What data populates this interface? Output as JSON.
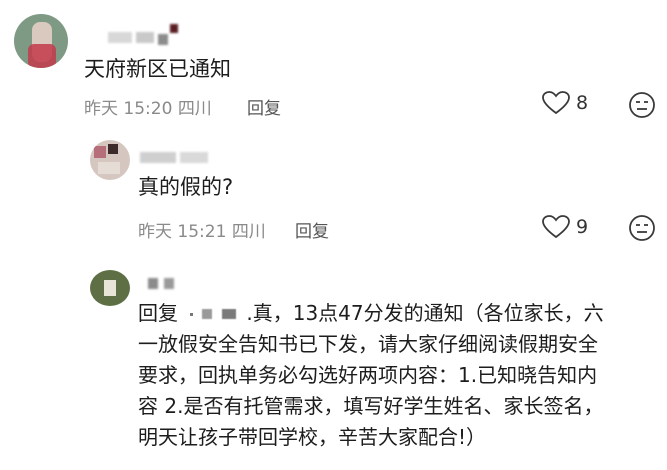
{
  "comments": [
    {
      "text": "天府新区已通知",
      "time": "昨天 15:20",
      "location": "四川",
      "reply_label": "回复",
      "likes": "8"
    },
    {
      "text": "真的假的?",
      "time": "昨天 15:21",
      "location": "四川",
      "reply_label": "回复",
      "likes": "9"
    },
    {
      "reply_prefix": "回复",
      "lines": [
        ".真，13点47分发的通知（各位家长，六",
        "一放假安全告知书已下发，请大家仔细阅读假期安全",
        "要求，回执单务必勾选好两项内容：1.已知晓告知内",
        "容 2.是否有托管需求，填写好学生姓名、家长签名，",
        "明天让孩子带回学校，辛苦大家配合!）"
      ]
    }
  ],
  "colors": {
    "text": "#1d1d1d",
    "meta": "#8a8a8a",
    "icon": "#3a3a3a"
  }
}
